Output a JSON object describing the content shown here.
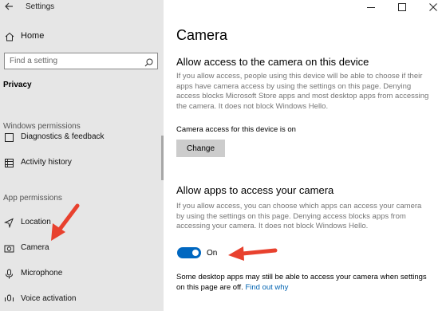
{
  "window": {
    "title": "Settings",
    "controls": {
      "minimize_icon": "minimize-icon",
      "maximize_icon": "maximize-icon",
      "close_icon": "close-icon"
    }
  },
  "nav": {
    "home_label": "Home",
    "search": {
      "placeholder": "Find a setting",
      "icon": "search-icon"
    },
    "current_section": "Privacy",
    "windows_permissions_heading": "Windows permissions",
    "windows_items": [
      {
        "label": "Diagnostics & feedback",
        "icon": "diagnostics-icon"
      },
      {
        "label": "Activity history",
        "icon": "activity-history-icon"
      }
    ],
    "app_permissions_heading": "App permissions",
    "app_items": [
      {
        "label": "Location",
        "icon": "location-icon"
      },
      {
        "label": "Camera",
        "icon": "camera-icon"
      },
      {
        "label": "Microphone",
        "icon": "microphone-icon"
      },
      {
        "label": "Voice activation",
        "icon": "voice-activation-icon"
      }
    ]
  },
  "content": {
    "page_title": "Camera",
    "device_section": {
      "heading": "Allow access to the camera on this device",
      "description": "If you allow access, people using this device will be able to choose if their apps have camera access by using the settings on this page. Denying access blocks Microsoft Store apps and most desktop apps from accessing the camera. It does not block Windows Hello.",
      "status": "Camera access for this device is on",
      "change_button": "Change"
    },
    "apps_section": {
      "heading": "Allow apps to access your camera",
      "description": "If you allow access, you can choose which apps can access your camera by using the settings on this page. Denying access blocks apps from accessing your camera. It does not block Windows Hello.",
      "toggle_label": "On",
      "toggle_on": true,
      "note": "Some desktop apps may still be able to access your camera when settings on this page are off.",
      "note_link": "Find out why"
    }
  },
  "colors": {
    "nav_background": "#e6e6e6",
    "accent": "#0067c0",
    "link": "#0063b1",
    "annotation_arrow": "#e8412e"
  }
}
